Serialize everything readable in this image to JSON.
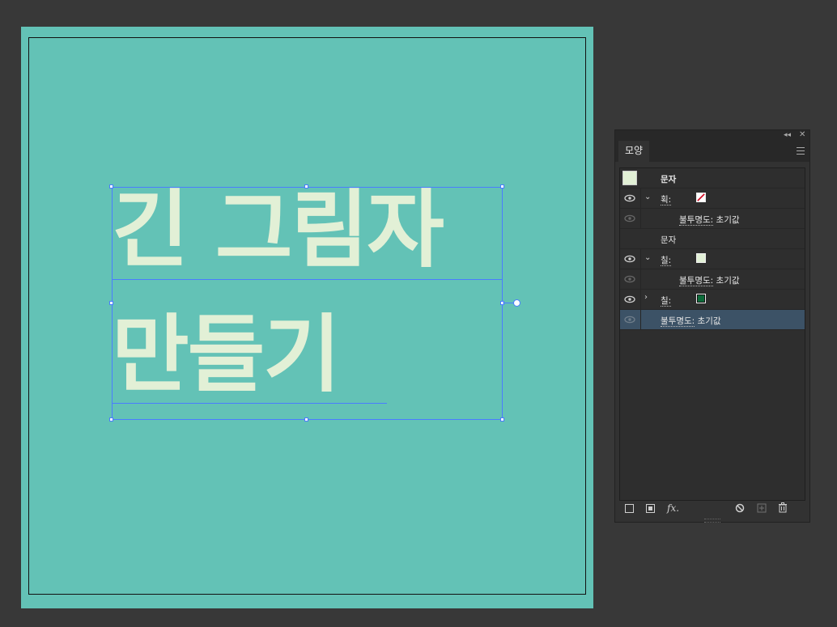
{
  "artboard": {
    "background": "#63c2b6",
    "text_color": "#e2f0d6",
    "lines": [
      "긴 그림자",
      "만들기"
    ]
  },
  "panel": {
    "tab_label": "모양",
    "rows": [
      {
        "kind": "header",
        "label": "문자",
        "swatch": "#e2f0d6"
      },
      {
        "kind": "stroke",
        "label": "획:",
        "eye": true,
        "expanded": true,
        "swatch": "none-red"
      },
      {
        "kind": "opacity",
        "prefix": "불투명도:",
        "value": "초기값",
        "eye_dim": true
      },
      {
        "kind": "group",
        "label": "문자"
      },
      {
        "kind": "fill",
        "label": "칠:",
        "eye": true,
        "expanded": true,
        "swatch": "#e2f0d6"
      },
      {
        "kind": "opacity",
        "prefix": "불투명도:",
        "value": "초기값",
        "eye_dim": true
      },
      {
        "kind": "fill",
        "label": "칠:",
        "eye": true,
        "expanded": false,
        "swatch": "#0d6b3a"
      },
      {
        "kind": "opacity-root",
        "prefix": "불투명도:",
        "value": "초기값",
        "eye_dim": true,
        "selected": true
      }
    ],
    "bottom_tools": {
      "fx_label": "fx."
    }
  }
}
